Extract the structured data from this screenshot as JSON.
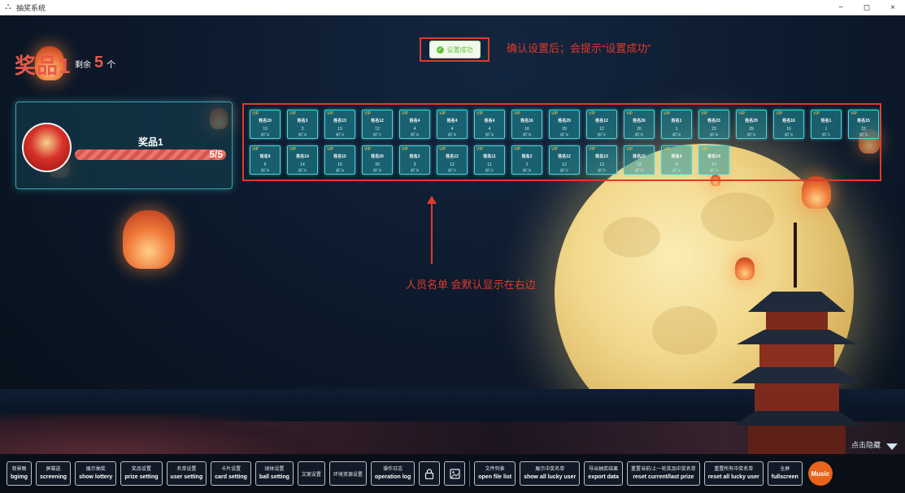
{
  "window": {
    "title": "抽奖系统",
    "controls": [
      "−",
      "◻",
      "×"
    ]
  },
  "prize": {
    "title": "奖品1",
    "remain_label": "剩余",
    "remain_count": "5",
    "remain_unit": "个",
    "card_name": "奖品1",
    "progress_text": "5/5",
    "progress_fraction": 1.0
  },
  "toast": {
    "text": "设置成功",
    "icon": "check-circle-icon"
  },
  "annotations": {
    "top": "确认设置后；会提示“设置成功”",
    "middle": "人员名单 会默认显示在右边"
  },
  "users": [
    {
      "tag": "VIP",
      "name": "姓名19",
      "num": "19",
      "dept": "部门8"
    },
    {
      "tag": "VIP",
      "name": "姓名3",
      "num": "3",
      "dept": "部门8"
    },
    {
      "tag": "VIP",
      "name": "姓名13",
      "num": "13",
      "dept": "部门4"
    },
    {
      "tag": "VIP",
      "name": "姓名12",
      "num": "12",
      "dept": "部门1"
    },
    {
      "tag": "VIP",
      "name": "姓名4",
      "num": "4",
      "dept": "部门8"
    },
    {
      "tag": "VIP",
      "name": "姓名4",
      "num": "4",
      "dept": "部门8"
    },
    {
      "tag": "VIP",
      "name": "姓名4",
      "num": "4",
      "dept": "部门8"
    },
    {
      "tag": "VIP",
      "name": "姓名16",
      "num": "16",
      "dept": "部门8"
    },
    {
      "tag": "VIP",
      "name": "姓名29",
      "num": "29",
      "dept": "部门6"
    },
    {
      "tag": "VIP",
      "name": "姓名12",
      "num": "12",
      "dept": "部门2"
    },
    {
      "tag": "VIP",
      "name": "姓名26",
      "num": "26",
      "dept": "部门8"
    },
    {
      "tag": "VIP",
      "name": "姓名1",
      "num": "1",
      "dept": "部门8"
    },
    {
      "tag": "VIP",
      "name": "姓名23",
      "num": "23",
      "dept": "部门8"
    },
    {
      "tag": "VIP",
      "name": "姓名29",
      "num": "29",
      "dept": "部门8"
    },
    {
      "tag": "VIP",
      "name": "姓名16",
      "num": "16",
      "dept": "部门6"
    },
    {
      "tag": "VIP",
      "name": "姓名1",
      "num": "1",
      "dept": "部门1"
    },
    {
      "tag": "VIP",
      "name": "姓名15",
      "num": "15",
      "dept": "部门3"
    },
    {
      "tag": "VIP",
      "name": "姓名9",
      "num": "9",
      "dept": "部门8"
    },
    {
      "tag": "VIP",
      "name": "姓名14",
      "num": "14",
      "dept": "部门4"
    },
    {
      "tag": "VIP",
      "name": "姓名15",
      "num": "15",
      "dept": "部门6"
    },
    {
      "tag": "VIP",
      "name": "姓名20",
      "num": "20",
      "dept": "部门8"
    },
    {
      "tag": "VIP",
      "name": "姓名3",
      "num": "3",
      "dept": "部门8"
    },
    {
      "tag": "VIP",
      "name": "姓名12",
      "num": "12",
      "dept": "部门1"
    },
    {
      "tag": "VIP",
      "name": "姓名11",
      "num": "11",
      "dept": "部门1"
    },
    {
      "tag": "VIP",
      "name": "姓名2",
      "num": "2",
      "dept": "部门8"
    },
    {
      "tag": "VIP",
      "name": "姓名12",
      "num": "12",
      "dept": "部门2"
    },
    {
      "tag": "VIP",
      "name": "姓名13",
      "num": "13",
      "dept": "部门2"
    },
    {
      "tag": "VIP",
      "name": "姓名22",
      "num": "22",
      "dept": "部门8"
    },
    {
      "tag": "VIP",
      "name": "姓名4",
      "num": "4",
      "dept": "部门8"
    },
    {
      "tag": "VIP",
      "name": "姓名14",
      "num": "14",
      "dept": "部门4"
    }
  ],
  "corner": {
    "text": "点击隐藏"
  },
  "toolbar": {
    "bgimg": {
      "zh": "背景图",
      "en": "bgimg"
    },
    "screening": {
      "zh": "屏幕选",
      "en": "screening"
    },
    "show_lottery": {
      "zh": "展示抽奖",
      "en": "show lottery"
    },
    "prize_setting": {
      "zh": "奖品设置",
      "en": "prize setting"
    },
    "user_setting": {
      "zh": "名单设置",
      "en": "user setting"
    },
    "card_setting": {
      "zh": "卡片设置",
      "en": "card setting"
    },
    "ball_setting": {
      "zh": "球体设置",
      "en": "ball setting"
    },
    "text_setting": {
      "zh": "文案设置"
    },
    "env_setting": {
      "zh": "环境资源设置"
    },
    "operation_log": {
      "zh": "操作日志",
      "en": "operation log"
    },
    "lock_icon": "lock-icon",
    "image_icon": "image-icon",
    "open_file_list": {
      "zh": "文件列表",
      "en": "open file list"
    },
    "show_all_lucky_user": {
      "zh": "展示中奖名单",
      "en": "show all lucky user"
    },
    "export_data": {
      "zh": "导出抽奖结果",
      "en": "export data"
    },
    "reset_current_last_prize": {
      "zh": "重置当前/上一轮奖品中奖名单",
      "en": "reset current/last prize"
    },
    "reset_all_lucky_user": {
      "zh": "重置所有中奖名单",
      "en": "reset all lucky user"
    },
    "fullscreen": {
      "zh": "全屏",
      "en": "fullscreen"
    },
    "music": "Music"
  }
}
